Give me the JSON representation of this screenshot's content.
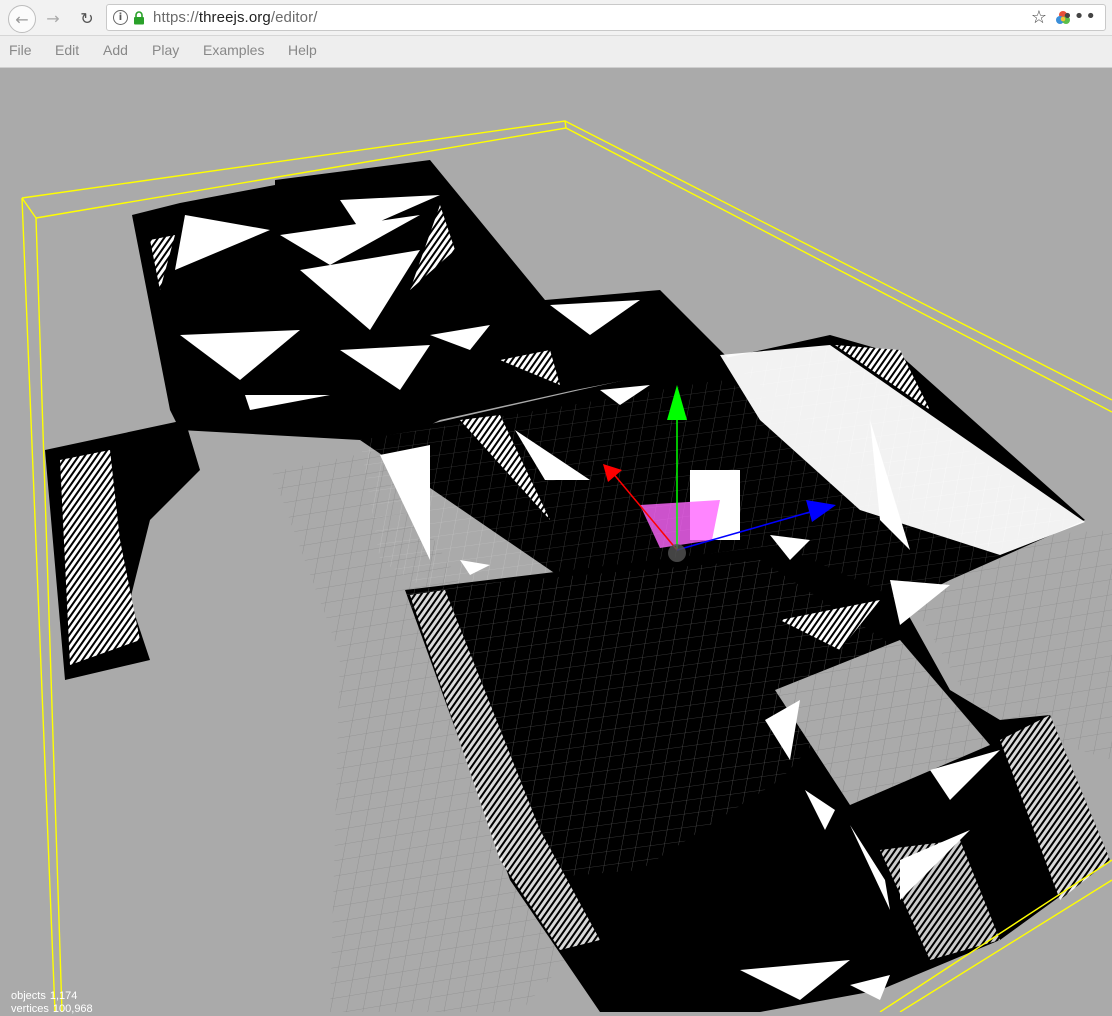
{
  "browser": {
    "url_scheme": "https://",
    "url_host": "threejs.org",
    "url_path": "/editor/",
    "icons": [
      "back-icon",
      "forward-icon",
      "reload-icon",
      "info-icon",
      "lock-icon",
      "star-icon",
      "extension-icon",
      "more-icon"
    ]
  },
  "menu": {
    "items": [
      "File",
      "Edit",
      "Add",
      "Play",
      "Examples",
      "Help"
    ]
  },
  "info": {
    "objects_label": "objects",
    "objects_value": "1,174",
    "vertices_label": "vertices",
    "vertices_value": "100,968"
  },
  "colors": {
    "viewport_bg": "#aaaaaa",
    "selection_box": "#ffff00",
    "gizmo_x": "#ff0000",
    "gizmo_y": "#00ff00",
    "gizmo_z": "#0000ff",
    "gizmo_plane": "#ff66ff"
  }
}
